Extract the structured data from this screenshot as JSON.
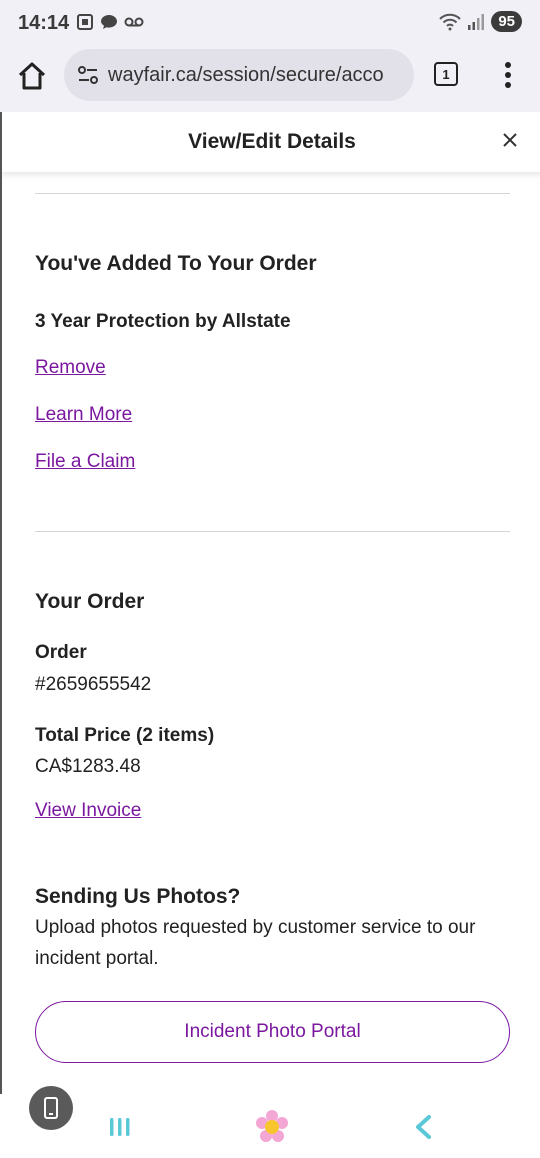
{
  "status_bar": {
    "time": "14:14",
    "battery": "95",
    "left_icons": [
      "screenshot-icon",
      "chat-bubble-icon",
      "voicemail-icon"
    ],
    "right_icons": [
      "wifi-icon",
      "signal-icon"
    ]
  },
  "browser": {
    "url": "wayfair.ca/session/secure/acco",
    "tab_count": "1"
  },
  "modal": {
    "title": "View/Edit Details",
    "close_icon": "close-icon"
  },
  "added_section": {
    "heading": "You've Added To Your Order",
    "item_title": "3 Year Protection by Allstate",
    "links": {
      "remove": "Remove",
      "learn_more": "Learn More",
      "file_claim": "File a Claim"
    }
  },
  "order_section": {
    "heading": "Your Order",
    "order_label": "Order",
    "order_number": "#2659655542",
    "total_label": "Total Price (2 items)",
    "total_value": "CA$1283.48",
    "invoice_link": "View Invoice"
  },
  "photos_section": {
    "heading": "Sending Us Photos?",
    "description": "Upload photos requested by customer service to our incident portal.",
    "button_label": "Incident Photo Portal"
  },
  "colors": {
    "link": "#7b189f",
    "chrome_bg": "#f1f0f7"
  }
}
